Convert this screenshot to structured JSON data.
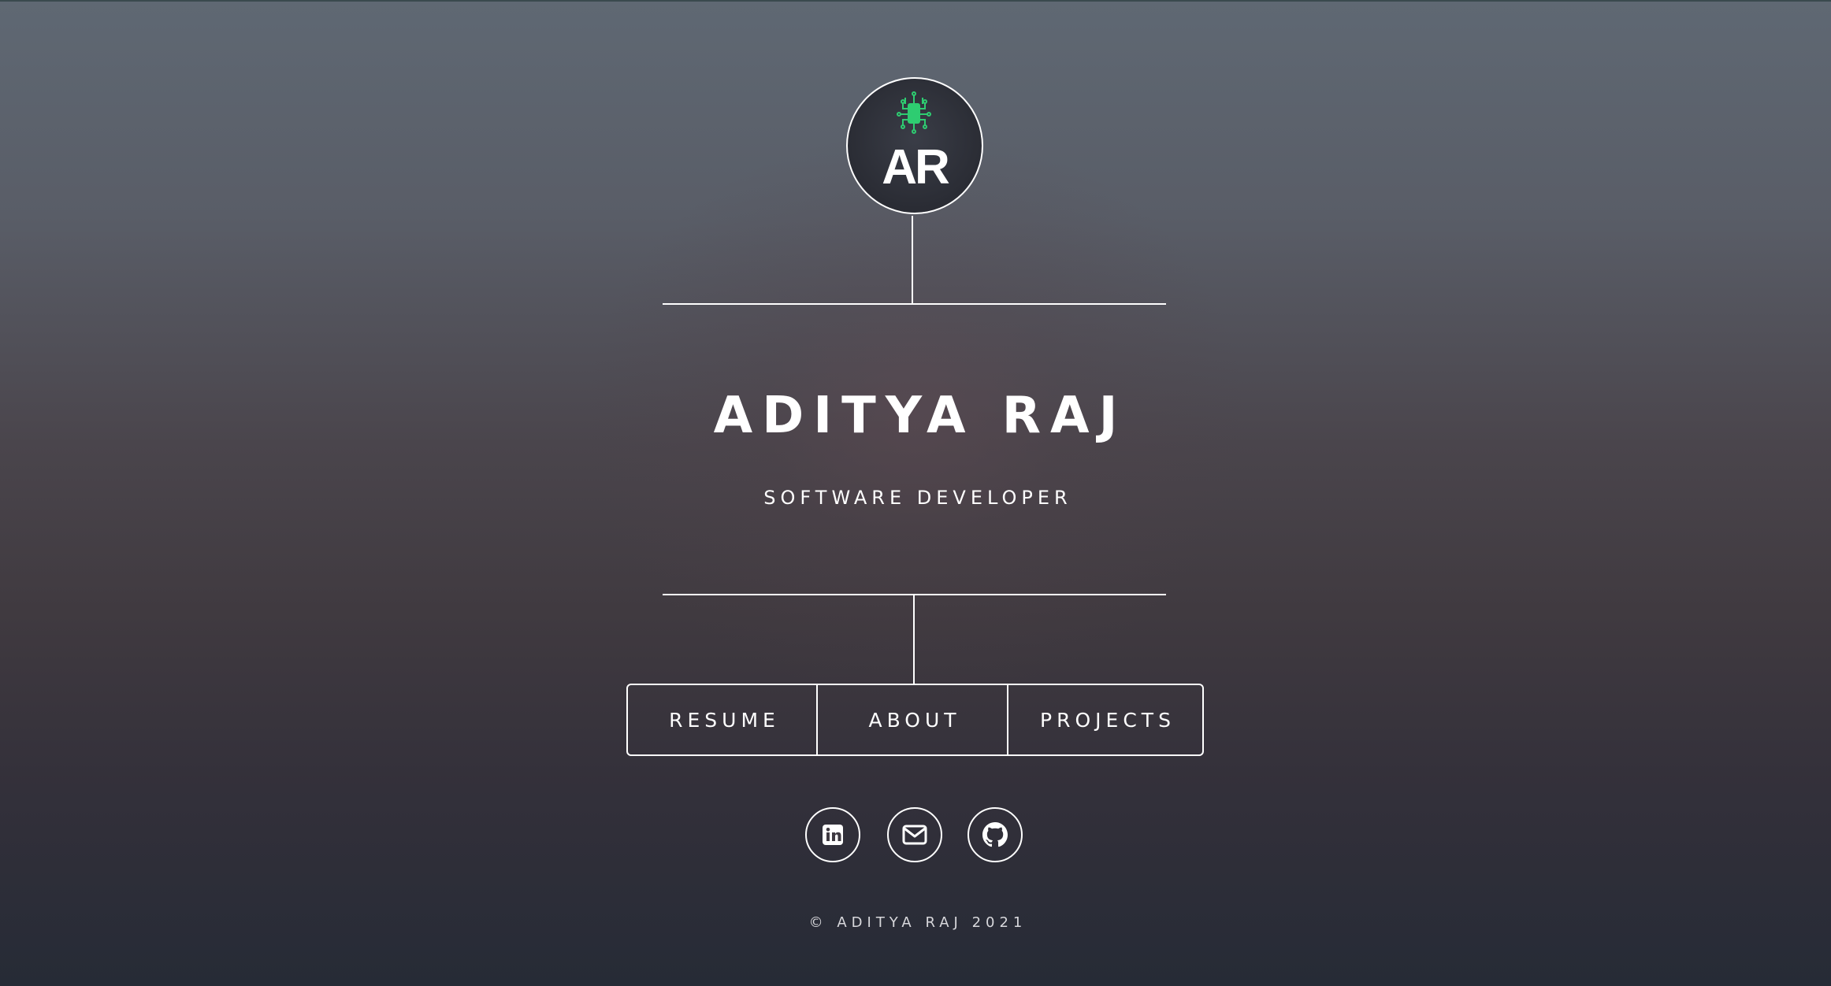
{
  "logo": {
    "text": "AR",
    "icon": "circuit-chip-icon",
    "accent_color": "#2ecc71"
  },
  "hero": {
    "name": "ADITYA RAJ",
    "title": "SOFTWARE DEVELOPER"
  },
  "nav": {
    "items": [
      {
        "label": "RESUME"
      },
      {
        "label": "ABOUT"
      },
      {
        "label": "PROJECTS"
      }
    ]
  },
  "social": [
    {
      "icon": "linkedin-icon"
    },
    {
      "icon": "mail-icon"
    },
    {
      "icon": "github-icon"
    }
  ],
  "footer": {
    "text": "© ADITYA RAJ 2021"
  }
}
